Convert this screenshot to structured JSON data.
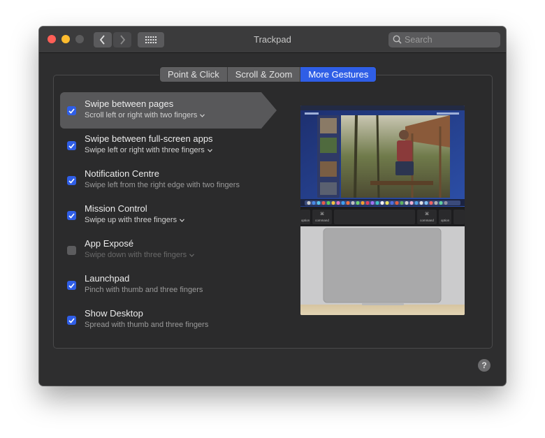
{
  "window": {
    "title": "Trackpad"
  },
  "search": {
    "placeholder": "Search"
  },
  "tabs": [
    {
      "label": "Point & Click",
      "active": false
    },
    {
      "label": "Scroll & Zoom",
      "active": false
    },
    {
      "label": "More Gestures",
      "active": true
    }
  ],
  "gestures": [
    {
      "title": "Swipe between pages",
      "subtitle": "Scroll left or right with two fingers",
      "checked": true,
      "has_dropdown": true,
      "selected": true
    },
    {
      "title": "Swipe between full-screen apps",
      "subtitle": "Swipe left or right with three fingers",
      "checked": true,
      "has_dropdown": true,
      "selected": false
    },
    {
      "title": "Notification Centre",
      "subtitle": "Swipe left from the right edge with two fingers",
      "checked": true,
      "has_dropdown": false,
      "selected": false
    },
    {
      "title": "Mission Control",
      "subtitle": "Swipe up with three fingers",
      "checked": true,
      "has_dropdown": true,
      "selected": false
    },
    {
      "title": "App Exposé",
      "subtitle": "Swipe down with three fingers",
      "checked": false,
      "has_dropdown": true,
      "selected": false
    },
    {
      "title": "Launchpad",
      "subtitle": "Pinch with thumb and three fingers",
      "checked": true,
      "has_dropdown": false,
      "selected": false
    },
    {
      "title": "Show Desktop",
      "subtitle": "Spread with thumb and three fingers",
      "checked": true,
      "has_dropdown": false,
      "selected": false
    }
  ],
  "preview": {
    "keyboard": {
      "left_key": "command",
      "right_key": "command",
      "far_left_key": "option",
      "far_right_key": "option"
    }
  },
  "help": {
    "label": "?"
  },
  "colors": {
    "accent": "#2f5ee6",
    "window_bg": "#2e2e2f",
    "titlebar_bg": "#3b3b3c"
  }
}
